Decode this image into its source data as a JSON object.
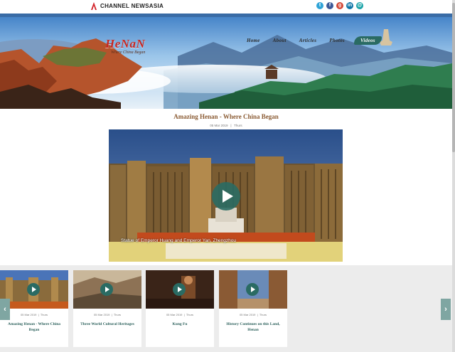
{
  "header": {
    "brand": "CHANNEL NEWSASIA",
    "social_icons": [
      "twitter-icon",
      "facebook-icon",
      "googleplus-icon",
      "linkedin-icon",
      "email-icon"
    ],
    "social_colors": [
      "#2fa3d7",
      "#3b5998",
      "#d34836",
      "#0e76a8",
      "#1aa3a8"
    ],
    "social_glyphs": [
      "t",
      "f",
      "g",
      "in",
      "@"
    ]
  },
  "logo": {
    "title": "HeNaN",
    "subtitle": "Where China Began"
  },
  "nav": {
    "items": [
      "Home",
      "About",
      "Articles",
      "Photos",
      "Videos"
    ],
    "active": "Videos"
  },
  "article": {
    "title": "Amazing Henan - Where China Began",
    "date": "05 Mar 2019",
    "author": "Thurs",
    "video_caption": "Statue of Emperor Huang and Emperor Yan, Zhengzhou"
  },
  "cards": [
    {
      "title": "Amazing Henan - Where China Began",
      "date": "05 Mar 2019",
      "author": "Thurs"
    },
    {
      "title": "Three World Cultural Heritages",
      "date": "05 Mar 2019",
      "author": "Thurs"
    },
    {
      "title": "Kung Fu",
      "date": "05 Mar 2019",
      "author": "Thurs"
    },
    {
      "title": "History Continues on this Land, Henan",
      "date": "05 Mar 2019",
      "author": "Thurs"
    }
  ],
  "carousel": {
    "prev": "‹",
    "next": "›"
  },
  "colors": {
    "accent": "#2a6b63",
    "title": "#8a5b33",
    "logo": "#c62722"
  }
}
